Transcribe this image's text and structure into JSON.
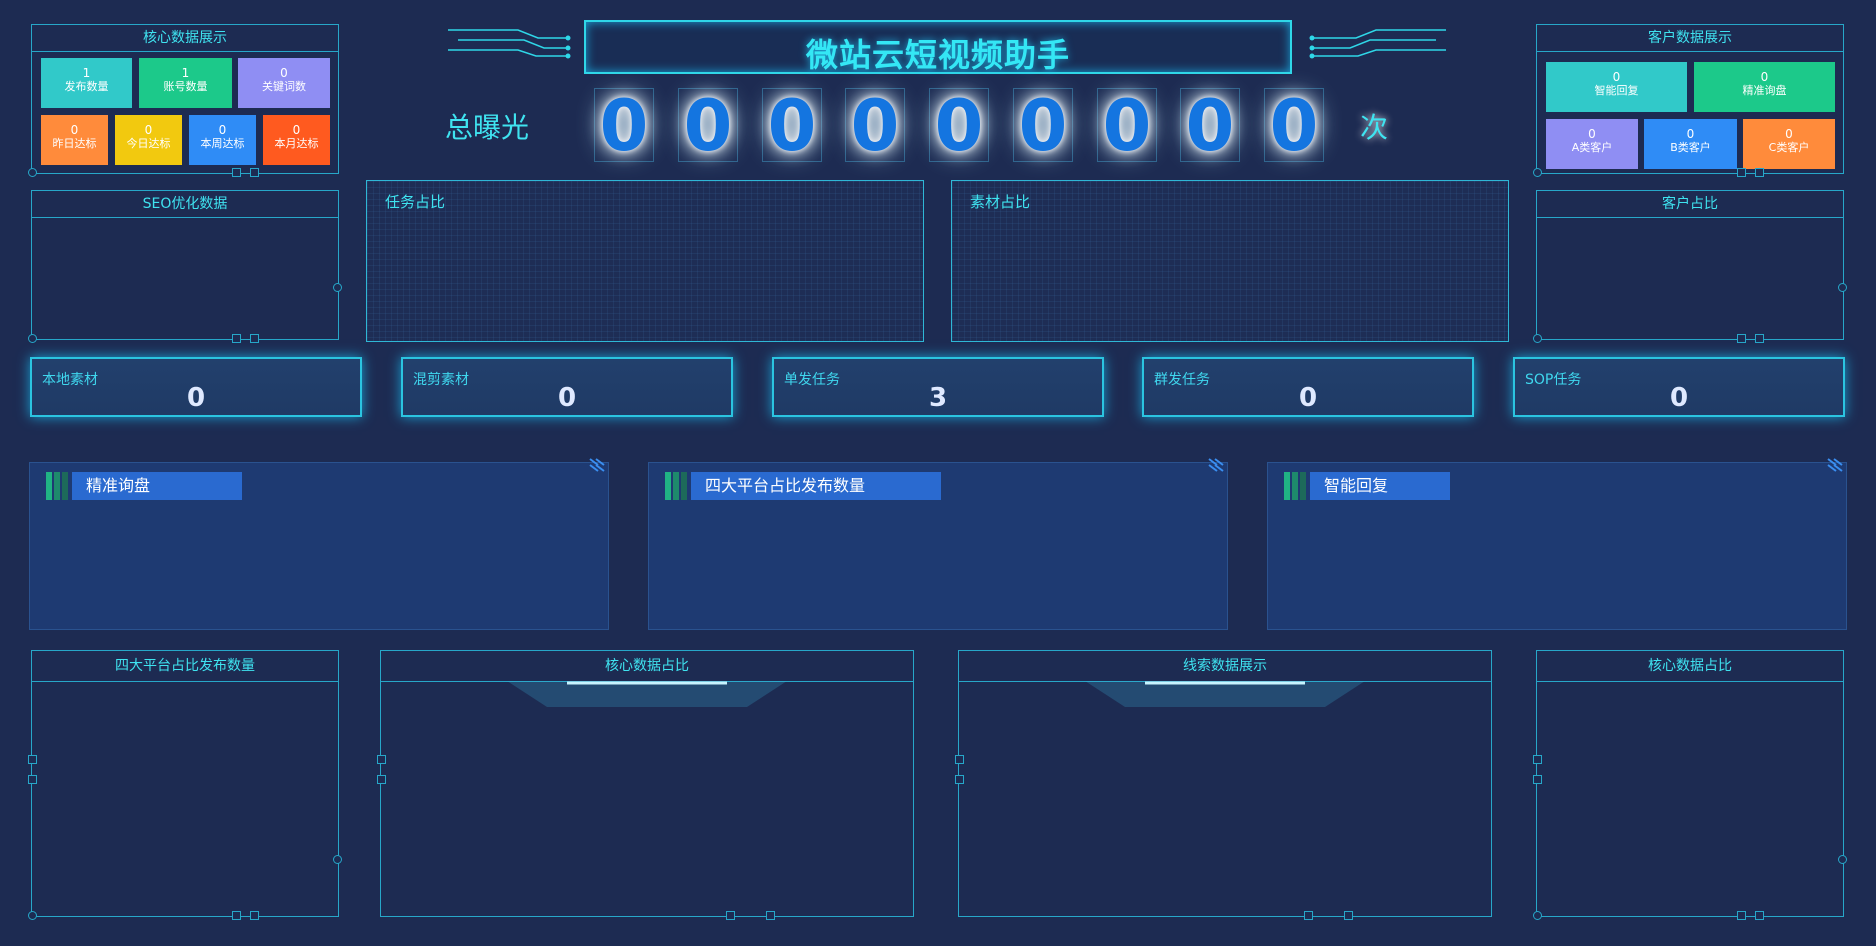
{
  "app_title": "微站云短视频助手",
  "exposure": {
    "label": "总曝光",
    "digits": [
      "0",
      "0",
      "0",
      "0",
      "0",
      "0",
      "0",
      "0",
      "0"
    ],
    "unit": "次"
  },
  "core_panel": {
    "title": "核心数据展示",
    "tiles": [
      {
        "label": "发布数量",
        "value": "1",
        "color": "#31c9c9"
      },
      {
        "label": "账号数量",
        "value": "1",
        "color": "#1cc98a"
      },
      {
        "label": "关键词数",
        "value": "0",
        "color": "#8f8ef3"
      },
      {
        "label": "昨日达标",
        "value": "0",
        "color": "#ff8b3b"
      },
      {
        "label": "今日达标",
        "value": "0",
        "color": "#f2c90f"
      },
      {
        "label": "本周达标",
        "value": "0",
        "color": "#2f8cf6"
      },
      {
        "label": "本月达标",
        "value": "0",
        "color": "#ff5a1f"
      }
    ]
  },
  "customer_panel": {
    "title": "客户数据展示",
    "tiles": [
      {
        "label": "智能回复",
        "value": "0",
        "color": "#31c9c9"
      },
      {
        "label": "精准询盘",
        "value": "0",
        "color": "#1cc98a"
      },
      {
        "label": "A类客户",
        "value": "0",
        "color": "#8f8ef3"
      },
      {
        "label": "B类客户",
        "value": "0",
        "color": "#2f8cf6"
      },
      {
        "label": "C类客户",
        "value": "0",
        "color": "#ff8b3b"
      }
    ]
  },
  "seo_panel": {
    "title": "SEO优化数据"
  },
  "customer_ratio_panel": {
    "title": "客户占比"
  },
  "task_ratio": {
    "title": "任务占比"
  },
  "material_ratio": {
    "title": "素材占比"
  },
  "stats": [
    {
      "label": "本地素材",
      "value": "0"
    },
    {
      "label": "混剪素材",
      "value": "0"
    },
    {
      "label": "单发任务",
      "value": "3"
    },
    {
      "label": "群发任务",
      "value": "0"
    },
    {
      "label": "SOP任务",
      "value": "0"
    }
  ],
  "mid_panels": [
    {
      "title": "精准询盘"
    },
    {
      "title": "四大平台占比发布数量"
    },
    {
      "title": "智能回复"
    }
  ],
  "bottom_panels": [
    {
      "title": "四大平台占比发布数量"
    },
    {
      "title": "核心数据占比"
    },
    {
      "title": "线索数据展示"
    },
    {
      "title": "核心数据占比"
    }
  ],
  "colors": {
    "accent": "#3fe3f0",
    "frame": "#27a7c9",
    "background": "#1d2b52"
  }
}
